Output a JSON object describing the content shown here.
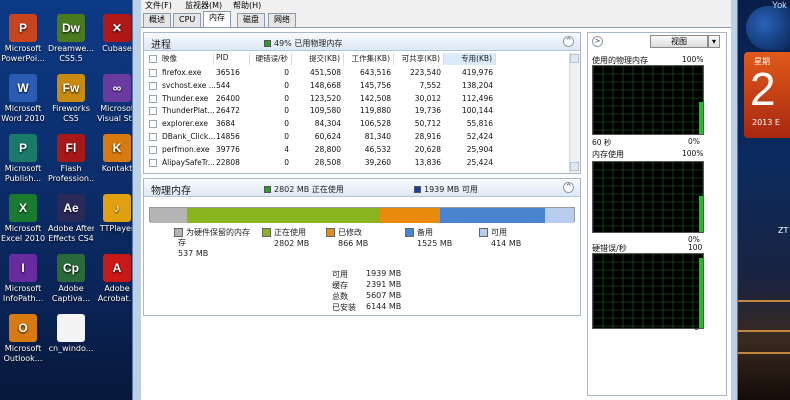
{
  "desktop": {
    "icons": [
      {
        "name": "powerpoint",
        "label1": "Microsoft",
        "label2": "PowerPoi...",
        "glyph": "P",
        "color": "#c8441c"
      },
      {
        "name": "dreamweaver",
        "label1": "Dreamwe...",
        "label2": "CS5.5",
        "glyph": "Dw",
        "color": "#4a7a20"
      },
      {
        "name": "cubase",
        "label1": "Cubase",
        "label2": "",
        "glyph": "✕",
        "color": "#b01818"
      },
      {
        "name": "word",
        "label1": "Microsoft",
        "label2": "Word 2010",
        "glyph": "W",
        "color": "#2a5cb4"
      },
      {
        "name": "fireworks",
        "label1": "Fireworks",
        "label2": "CS5",
        "glyph": "Fw",
        "color": "#c88a10"
      },
      {
        "name": "visual-studio",
        "label1": "Microsof",
        "label2": "Visual Stu",
        "glyph": "∞",
        "color": "#6a3aa0"
      },
      {
        "name": "publisher",
        "label1": "Microsoft",
        "label2": "Publish...",
        "glyph": "P",
        "color": "#1a7a6a"
      },
      {
        "name": "flash",
        "label1": "Flash",
        "label2": "Profession...",
        "glyph": "Fl",
        "color": "#a81818"
      },
      {
        "name": "kontakt",
        "label1": "Kontakt",
        "label2": "",
        "glyph": "K",
        "color": "#d87a10"
      },
      {
        "name": "excel",
        "label1": "Microsoft",
        "label2": "Excel 2010",
        "glyph": "X",
        "color": "#1a7a30"
      },
      {
        "name": "after-effects",
        "label1": "Adobe After",
        "label2": "Effects CS4",
        "glyph": "Ae",
        "color": "#2a2a5a"
      },
      {
        "name": "ttplayer",
        "label1": "TTPlayer",
        "label2": "",
        "glyph": "♪",
        "color": "#e0a010"
      },
      {
        "name": "infopath",
        "label1": "Microsoft",
        "label2": "InfoPath...",
        "glyph": "I",
        "color": "#6a2aa0"
      },
      {
        "name": "captivate",
        "label1": "Adobe",
        "label2": "Captiva...",
        "glyph": "Cp",
        "color": "#2a6a3a"
      },
      {
        "name": "acrobat",
        "label1": "Adobe",
        "label2": "Acrobat...",
        "glyph": "A",
        "color": "#c81818"
      },
      {
        "name": "outlook",
        "label1": "Microsoft",
        "label2": "Outlook...",
        "glyph": "O",
        "color": "#d87a10"
      },
      {
        "name": "cn-windows",
        "label1": "cn_windo...",
        "label2": "",
        "glyph": "",
        "color": "#f4f4f4"
      }
    ]
  },
  "side": {
    "clock_text": "Yok",
    "cal_week": "星期",
    "cal_day": "2",
    "cal_month": "2013 E",
    "zt": "ZT"
  },
  "menu": [
    "文件(F)",
    "监视器(M)",
    "帮助(H)"
  ],
  "tabs": [
    "概述",
    "CPU",
    "内存",
    "磁盘",
    "网络"
  ],
  "process": {
    "title": "进程",
    "legend": "49% 已用物理内存",
    "columns": [
      "映像",
      "PID",
      "硬错误/秒",
      "提交(KB)",
      "工作集(KB)",
      "可共享(KB)",
      "专用(KB)"
    ],
    "rows": [
      [
        "firefox.exe",
        "36516",
        "0",
        "451,508",
        "643,516",
        "223,540",
        "419,976"
      ],
      [
        "svchost.exe ...",
        "544",
        "0",
        "148,668",
        "145,756",
        "7,552",
        "138,204"
      ],
      [
        "Thunder.exe",
        "26400",
        "0",
        "123,520",
        "142,508",
        "30,012",
        "112,496"
      ],
      [
        "ThunderPlat...",
        "26472",
        "0",
        "109,580",
        "119,880",
        "19,736",
        "100,144"
      ],
      [
        "explorer.exe",
        "3684",
        "0",
        "84,304",
        "106,528",
        "50,712",
        "55,816"
      ],
      [
        "DBank_Click...",
        "14856",
        "0",
        "60,624",
        "81,340",
        "28,916",
        "52,424"
      ],
      [
        "perfmon.exe",
        "39776",
        "4",
        "28,800",
        "46,532",
        "20,628",
        "25,904"
      ],
      [
        "AlipaySafeTr...",
        "22808",
        "0",
        "28,508",
        "39,260",
        "13,836",
        "25,424"
      ]
    ]
  },
  "physical": {
    "title": "物理内存",
    "legend_used": "2802 MB 正在使用",
    "legend_free": "1939 MB 可用",
    "bar": [
      {
        "name": "hardware",
        "color": "#b4b4b4",
        "value": 537
      },
      {
        "name": "in-use",
        "color": "#8ab41e",
        "value": 2802
      },
      {
        "name": "modified",
        "color": "#e88a0c",
        "value": 866
      },
      {
        "name": "standby",
        "color": "#4a84d0",
        "value": 1525
      },
      {
        "name": "free",
        "color": "#b6cdee",
        "value": 414
      }
    ],
    "items": [
      {
        "label": "为硬件保留的内存",
        "label2": "存",
        "value": "537 MB",
        "color": "#b4b4b4"
      },
      {
        "label": "正在使用",
        "value": "2802 MB",
        "color": "#8ab41e"
      },
      {
        "label": "已修改",
        "value": "866 MB",
        "color": "#e88a0c"
      },
      {
        "label": "备用",
        "value": "1525 MB",
        "color": "#4a84d0"
      },
      {
        "label": "可用",
        "value": "414 MB",
        "color": "#b6cdee"
      }
    ],
    "stats": [
      {
        "label": "可用",
        "value": "1939 MB"
      },
      {
        "label": "缓存",
        "value": "2391 MB"
      },
      {
        "label": "总数",
        "value": "5607 MB"
      },
      {
        "label": "已安装",
        "value": "6144 MB"
      }
    ]
  },
  "graphs": {
    "view_label": "视图",
    "g1_title": "使用的物理内存",
    "g1_max": "100%",
    "g1_time": "60 秒",
    "g1_min": "0%",
    "g2_title": "内存使用",
    "g2_max": "100%",
    "g2_min": "0%",
    "g3_title": "硬错误/秒",
    "g3_max": "100",
    "g3_min": "0"
  }
}
